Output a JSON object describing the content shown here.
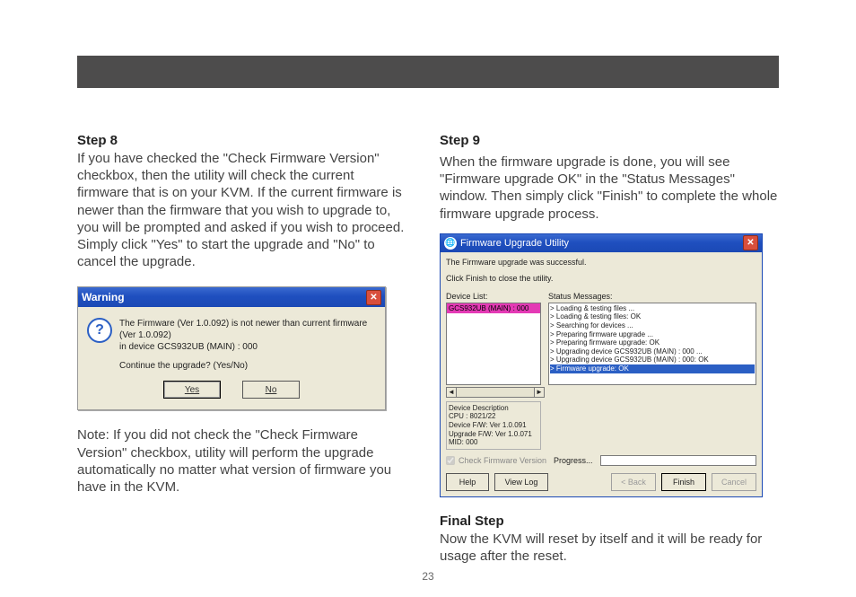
{
  "page_number": "23",
  "left": {
    "step8_heading": "Step 8",
    "step8_body": "If you have checked the \"Check Firmware Version\" checkbox, then the utility will check the current firmware that is on your KVM. If the current firmware is newer than the firmware that you wish to upgrade to, you will be prompted and asked if you wish to proceed. Simply click \"Yes\" to start the upgrade and \"No\" to cancel the upgrade.",
    "note": "Note: If you did not check the \"Check Firmware Version\" checkbox, utility will perform the upgrade automatically no matter what version of firmware you have in the KVM."
  },
  "right": {
    "step9_heading": "Step 9",
    "step9_body": "When the firmware upgrade is done, you will see \"Firmware upgrade OK\" in the \"Status Messages\" window. Then simply click \"Finish\" to complete the whole firmware upgrade process.",
    "final_heading": "Final Step",
    "final_body": "Now the KVM will reset by itself and it will be ready for usage after the reset."
  },
  "warning_dialog": {
    "title": "Warning",
    "icon_glyph": "?",
    "message_line1": "The Firmware (Ver 1.0.092) is not newer than current firmware (Ver 1.0.092)",
    "message_line2": "in device GCS932UB (MAIN) : 000",
    "message_line3": "Continue the upgrade? (Yes/No)",
    "yes": "Yes",
    "no": "No"
  },
  "fwu": {
    "title": "Firmware Upgrade Utility",
    "line1": "The Firmware upgrade was successful.",
    "line2": "Click Finish to close the utility.",
    "device_list_label": "Device List:",
    "status_label": "Status Messages:",
    "device_selected": "GCS932UB (MAIN) : 000",
    "status_lines": [
      "> Loading & testing files ...",
      "> Loading & testing files: OK",
      "> Searching for devices ...",
      "> Preparing firmware upgrade ...",
      "> Preparing firmware upgrade: OK",
      "> Upgrading device GCS932UB (MAIN) : 000 ...",
      "> Upgrading device GCS932UB (MAIN) : 000: OK"
    ],
    "status_selected": "> Firmware upgrade: OK",
    "devdesc_heading": "Device Description",
    "devdesc_cpu": "CPU : 8021/22",
    "devdesc_fw": "Device F/W: Ver 1.0.091",
    "devdesc_up": "Upgrade F/W: Ver 1.0.071",
    "devdesc_mid": "MID: 000",
    "check_label": "Check Firmware Version",
    "progress_label": "Progress...",
    "btn_help": "Help",
    "btn_viewlog": "View Log",
    "btn_back": "< Back",
    "btn_finish": "Finish",
    "btn_cancel": "Cancel"
  }
}
